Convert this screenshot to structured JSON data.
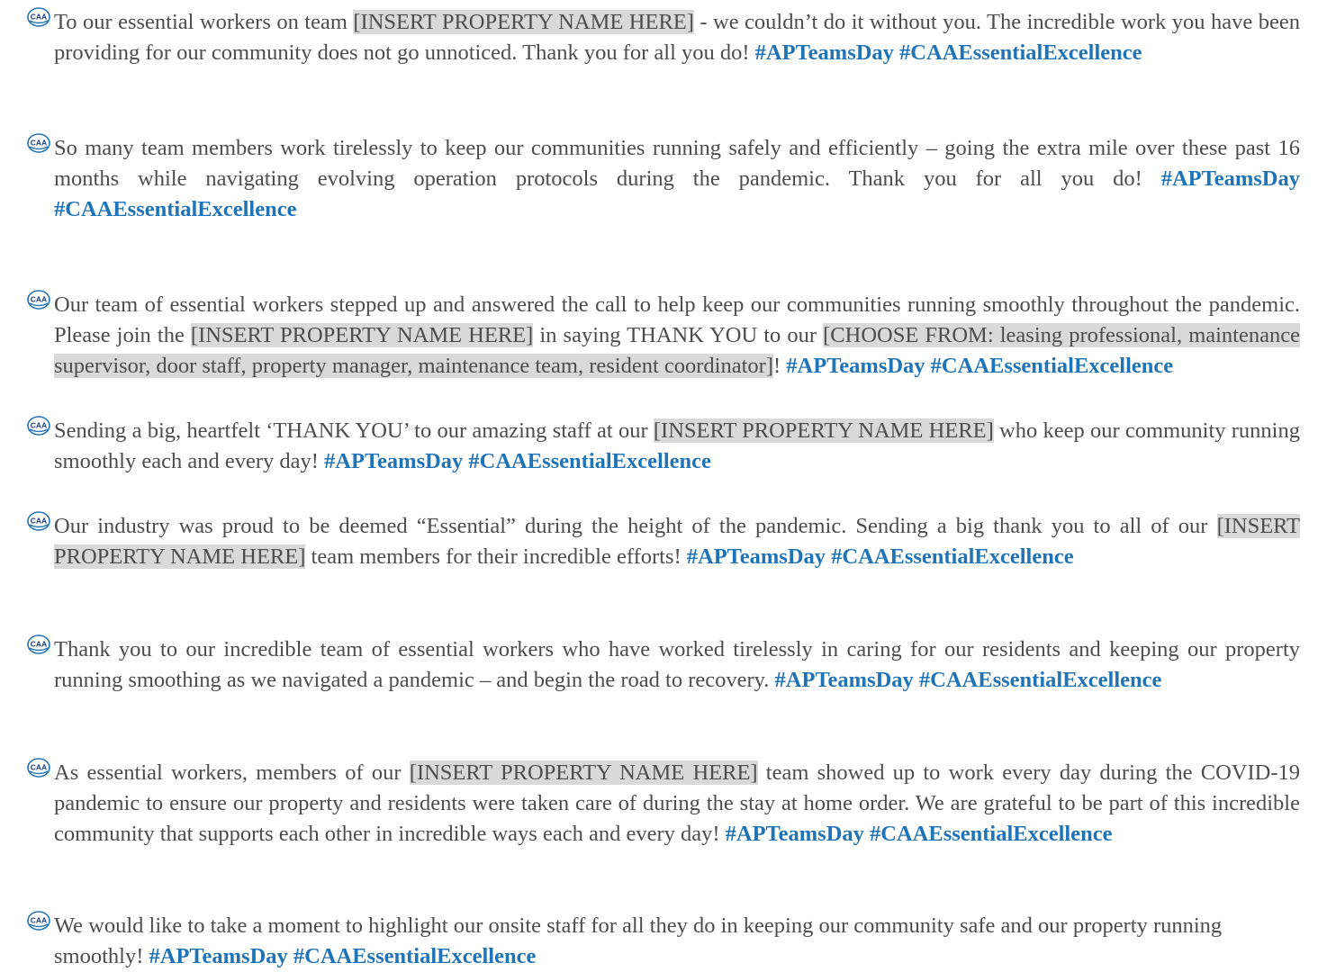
{
  "bullet_icon": "caa-logo-icon",
  "colors": {
    "body_text": "#4d4d4d",
    "hashtag": "#1f73b7",
    "highlight": "#d9d9d9"
  },
  "posts": [
    {
      "segments": [
        {
          "t": "To our essential workers on team "
        },
        {
          "t": "[INSERT PROPERTY NAME HERE]",
          "hl": true
        },
        {
          "t": " - we couldn’t do it without you. The incredible work you have been providing for our community does not go unnoticed. Thank you for all you do! "
        },
        {
          "t": "#APTeamsDay #CAAEssentialExcellence",
          "tag": true
        }
      ]
    },
    {
      "segments": [
        {
          "t": "So many team members work tirelessly to keep our communities running safely and efficiently – going the extra mile over these past 16 months while navigating evolving operation protocols during the pandemic. Thank you for all you do!  "
        },
        {
          "t": "#APTeamsDay #CAAEssentialExcellence",
          "tag": true
        }
      ]
    },
    {
      "segments": [
        {
          "t": "Our team of  essential workers stepped up and answered the call to help keep our communities running smoothly throughout the pandemic. Please join the "
        },
        {
          "t": "[INSERT PROPERTY NAME HERE]",
          "hl": true
        },
        {
          "t": " in saying THANK YOU to our "
        },
        {
          "t": "[CHOOSE FROM: leasing professional, maintenance supervisor, door staff, property manager, maintenance team, resident coordinator]",
          "hl": true
        },
        {
          "t": "! "
        },
        {
          "t": "#APTeamsDay #CAAEssentialExcellence",
          "tag": true
        }
      ]
    },
    {
      "segments": [
        {
          "t": "Sending a big, heartfelt ‘THANK YOU’ to our amazing staff at our "
        },
        {
          "t": "[INSERT PROPERTY NAME HERE]",
          "hl": true
        },
        {
          "t": " who keep our community running smoothly each and every day! "
        },
        {
          "t": "#APTeamsDay #CAAEssentialExcellence",
          "tag": true
        }
      ]
    },
    {
      "segments": [
        {
          "t": "Our industry was proud to be deemed “Essential” during the height of the pandemic.  Sending a big thank you to all of our "
        },
        {
          "t": "[INSERT PROPERTY NAME HERE]",
          "hl": true
        },
        {
          "t": " team members for their incredible efforts! "
        },
        {
          "t": "#APTeamsDay #CAAEssentialExcellence",
          "tag": true
        }
      ]
    },
    {
      "segments": [
        {
          "t": "Thank you to our incredible team of essential workers who have worked tirelessly in caring for our residents and keeping our property running smoothing as we navigated a pandemic – and begin the road to recovery. "
        },
        {
          "t": "#APTeamsDay  #CAAEssentialExcellence",
          "tag": true
        }
      ]
    },
    {
      "segments": [
        {
          "t": "As essential workers, members of our "
        },
        {
          "t": "[INSERT PROPERTY NAME HERE]",
          "hl": true
        },
        {
          "t": " team showed up to work every day during the COVID-19 pandemic to ensure our property and residents were taken care of during the stay at home order. We are grateful to be part of this incredible community that supports each other in incredible ways each and every day! "
        },
        {
          "t": "#APTeamsDay #CAAEssentialExcellence",
          "tag": true
        }
      ]
    },
    {
      "segments": [
        {
          "t": "We would like to take a moment to highlight our onsite staff for all they do in keeping our community safe and our property running smoothly! "
        },
        {
          "t": "#APTeamsDay #CAAEssentialExcellence",
          "tag": true
        }
      ]
    }
  ]
}
